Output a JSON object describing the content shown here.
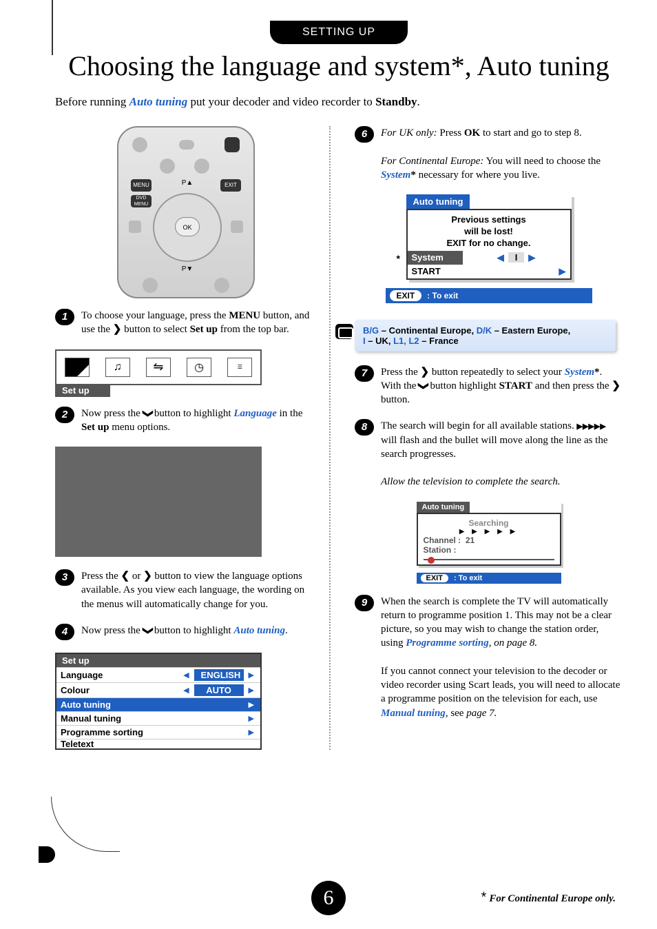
{
  "header_tag": "SETTING UP",
  "title": "Choosing the language and system*, Auto tuning",
  "intro": {
    "before": "Before running ",
    "emph": "Auto tuning",
    "after": " put your decoder and video recorder to ",
    "bold": "Standby",
    "end": "."
  },
  "remote": {
    "menu": "MENU",
    "p_up": "P▲",
    "exit": "EXIT",
    "dvd_menu": "DVD MENU",
    "ok": "OK",
    "p_down": "P▼"
  },
  "steps_left": {
    "1": {
      "a": "To choose your language, press the ",
      "b": "MENU",
      "c": " button, and use the ",
      "d": "❯",
      "e": " button to select ",
      "f": "Set up",
      "g": " from the top bar."
    },
    "2": {
      "a": "Now press the ",
      "b": "❯",
      "c": " button to highlight ",
      "d": "Language",
      "e": " in the ",
      "f": "Set up",
      "g": " menu options."
    },
    "3": {
      "a": "Press the ",
      "b": "❮",
      "c": " or ",
      "d": "❯",
      "e": " button to view the language options available. As you view each language, the wording on the menus will automatically change for you."
    },
    "4": {
      "a": "Now press the ",
      "b": "❯",
      "c": " button to highlight ",
      "d": "Auto tuning",
      "e": "."
    }
  },
  "osd_setup_label": "Set up",
  "setup_menu": {
    "header": "Set up",
    "rows": [
      {
        "label": "Language",
        "value": "ENGLISH",
        "arrows": true,
        "hl": false
      },
      {
        "label": "Colour",
        "value": "AUTO",
        "arrows": true,
        "hl": false
      },
      {
        "label": "Auto tuning",
        "value": "",
        "arrows": "right",
        "hl": true
      },
      {
        "label": "Manual tuning",
        "value": "",
        "arrows": "right",
        "hl": false
      },
      {
        "label": "Programme sorting",
        "value": "",
        "arrows": "right",
        "hl": false
      },
      {
        "label": "Teletext",
        "value": "",
        "arrows": "",
        "hl": false,
        "cut": true
      }
    ]
  },
  "steps_right": {
    "6": {
      "line1a": "For UK only:",
      "line1b": " Press ",
      "line1c": "OK",
      "line1d": " to start and go to step 8.",
      "line2a": "For Continental Europe:",
      "line2b": " You will need to choose the ",
      "line2c": "System",
      "line2d": "*",
      "line2e": " necessary for where you live."
    },
    "7": {
      "a": "Press the ",
      "b": "❯",
      "c": " button repeatedly to select your ",
      "d": "System",
      "e": "*",
      "f": ". With the ",
      "g": "❯",
      "h": " button highlight ",
      "i": "START",
      "j": " and then press the ",
      "k": "❯",
      "l": " button."
    },
    "8": {
      "a": "The search will begin for all available stations. ",
      "b": "▶▶▶▶▶",
      "c": " will flash and the bullet will move along the line as the search progresses.",
      "d": "Allow the television to complete the search."
    },
    "9": {
      "a": "When the search is complete the TV will automatically return to programme position 1. This may not be a clear picture, so you may wish to change the station order, using ",
      "b": "Programme sorting",
      "c": ", ",
      "d": "on page 8.",
      "e": "If you cannot connect your television to the decoder or video recorder using Scart leads, you will need to allocate a programme position on the television for each, use ",
      "f": "Manual tuning",
      "g": ", see ",
      "h": "page 7."
    }
  },
  "autotune": {
    "tab": "Auto tuning",
    "warn1": "Previous settings",
    "warn2": "will be lost!",
    "warn3": "EXIT for no change.",
    "system": "System",
    "sysval": "I",
    "start": "START"
  },
  "exit_bar": {
    "pill": "EXIT",
    "text": ": To exit"
  },
  "note": {
    "bg": "B/G",
    "bg_t": " – Continental Europe, ",
    "dk": "D/K",
    "dk_t": " – Eastern Europe, ",
    "i": "I",
    "i_t": " – UK, ",
    "l": "L1, L2",
    "l_t": " – France"
  },
  "search_box": {
    "tab": "Auto tuning",
    "searching": "Searching",
    "arrows": "▶ ▶ ▶ ▶ ▶",
    "channel_l": "Channel :",
    "channel_v": "21",
    "station_l": "Station  :",
    "station_v": ""
  },
  "page_number": "6",
  "footnote_star": "*",
  "footnote_text": "For Continental Europe only."
}
